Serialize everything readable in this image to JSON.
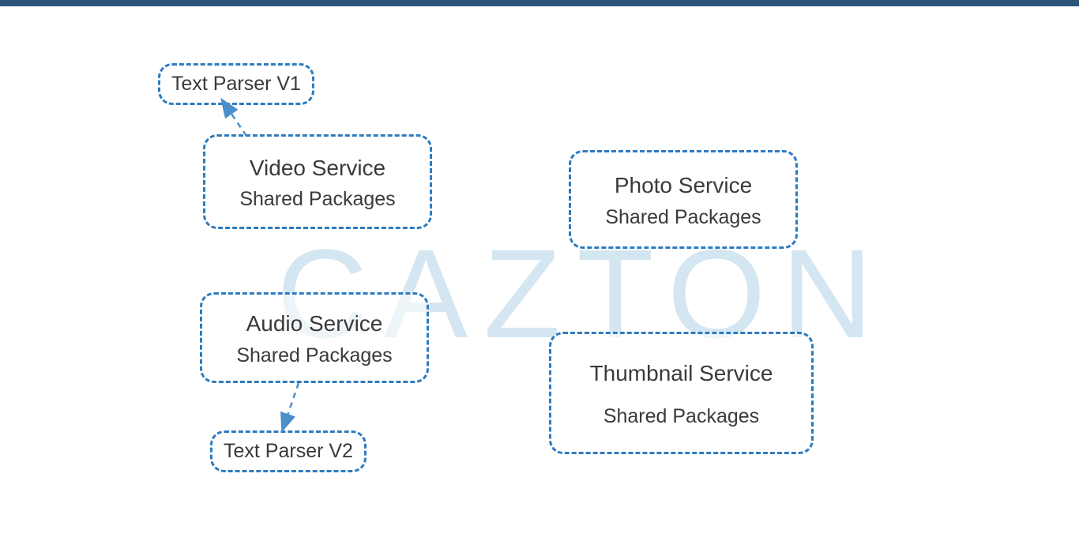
{
  "watermark": "CAZTON",
  "boxes": {
    "text_parser_v1": {
      "title": "Text Parser V1"
    },
    "video_service": {
      "title": "Video Service",
      "subtitle": "Shared Packages"
    },
    "photo_service": {
      "title": "Photo Service",
      "subtitle": "Shared Packages"
    },
    "audio_service": {
      "title": "Audio Service",
      "subtitle": "Shared Packages"
    },
    "thumbnail_service": {
      "title": "Thumbnail Service",
      "subtitle": "Shared Packages"
    },
    "text_parser_v2": {
      "title": "Text Parser V2"
    }
  },
  "colors": {
    "border": "#2d7bc0",
    "top_bar": "#2a5578",
    "watermark": "#d4e6f1"
  }
}
